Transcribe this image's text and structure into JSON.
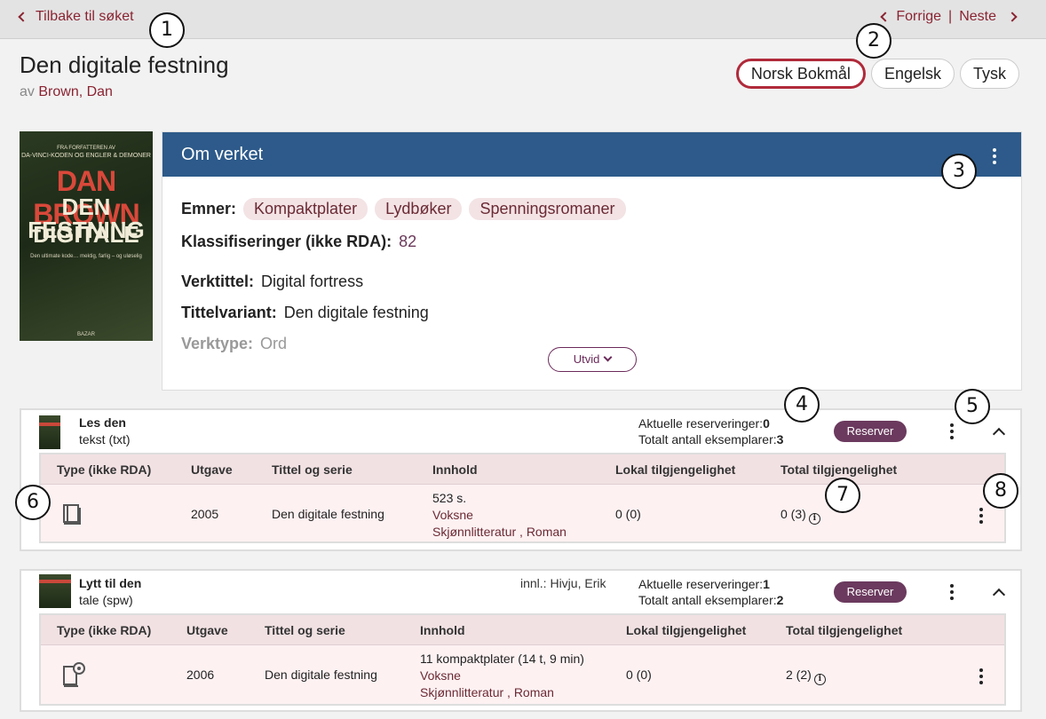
{
  "topbar": {
    "back_label": "Tilbake til søket",
    "prev_label": "Forrige",
    "separator": "|",
    "next_label": "Neste"
  },
  "work": {
    "title": "Den digitale festning",
    "by_prefix": "av",
    "author": "Brown, Dan"
  },
  "languages": [
    {
      "label": "Norsk Bokmål",
      "active": true
    },
    {
      "label": "Engelsk",
      "active": false
    },
    {
      "label": "Tysk",
      "active": false
    }
  ],
  "cover": {
    "tagline1": "FRA FORFATTEREN AV",
    "tagline2": "DA-VINCI-KODEN OG ENGLER & DEMONER",
    "author": "DAN BROWN",
    "title_line1": "DEN DIGITALE",
    "title_line2": "FESTNING",
    "subtitle": "Den ultimate kode… mektig, farlig – og uløselig",
    "publisher": "BAZAR"
  },
  "about": {
    "header": "Om verket",
    "subjects_label": "Emner:",
    "subjects": [
      "Kompaktplater",
      "Lydbøker",
      "Spenningsromaner"
    ],
    "classification_label": "Klassifiseringer (ikke RDA):",
    "classification_value": "82",
    "work_title_label": "Verktittel:",
    "work_title_value": "Digital fortress",
    "title_variant_label": "Tittelvariant:",
    "title_variant_value": "Den digitale festning",
    "work_type_label": "Verktype:",
    "work_type_value": "Ord",
    "expand_label": "Utvid"
  },
  "manifestations": [
    {
      "title": "Les den",
      "format": "tekst (txt)",
      "contributor": "",
      "current_reservations_label": "Aktuelle reserveringer:",
      "current_reservations": "0",
      "total_copies_label": "Totalt antall eksemplarer:",
      "total_copies": "3",
      "reserve_label": "Reserver",
      "columns": [
        "Type (ikke RDA)",
        "Utgave",
        "Tittel og serie",
        "Innhold",
        "Lokal tilgjengelighet",
        "Total tilgjengelighet"
      ],
      "row": {
        "type_icon": "book-icon",
        "edition": "2005",
        "title_series": "Den digitale festning",
        "content_line1": "523 s.",
        "content_line2": "Voksne",
        "content_line3": "Skjønnlitteratur , Roman",
        "local_availability": "0 (0)",
        "total_availability": "0 (3)"
      }
    },
    {
      "title": "Lytt til den",
      "format": "tale (spw)",
      "contributor": "innl.: Hivju, Erik",
      "current_reservations_label": "Aktuelle reserveringer:",
      "current_reservations": "1",
      "total_copies_label": "Totalt antall eksemplarer:",
      "total_copies": "2",
      "reserve_label": "Reserver",
      "columns": [
        "Type (ikke RDA)",
        "Utgave",
        "Tittel og serie",
        "Innhold",
        "Lokal tilgjengelighet",
        "Total tilgjengelighet"
      ],
      "row": {
        "type_icon": "audiobook-cd-icon",
        "edition": "2006",
        "title_series": "Den digitale festning",
        "content_line1": "11 kompaktplater (14 t, 9 min)",
        "content_line2": "Voksne",
        "content_line3": "Skjønnlitteratur , Roman",
        "local_availability": "0 (0)",
        "total_availability": "2 (2)"
      }
    }
  ],
  "callouts": [
    "1",
    "2",
    "3",
    "4",
    "5",
    "6",
    "7",
    "8"
  ],
  "colors": {
    "accent": "#8a2432",
    "panel_header": "#2d5a8a",
    "reserve_button": "#6b3a5e",
    "chip_bg": "#f3e3e5"
  }
}
